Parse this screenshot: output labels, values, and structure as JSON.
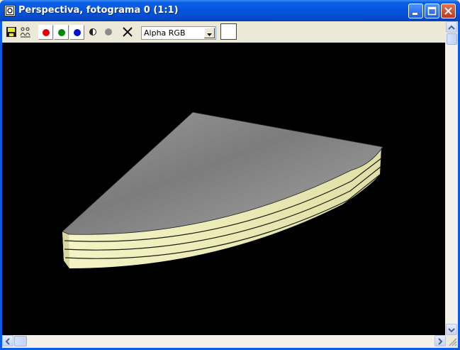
{
  "window": {
    "title": "Perspectiva, fotograma 0 (1:1)",
    "icon": "frame-window-icon"
  },
  "title_buttons": [
    "minimize-button",
    "maximize-button",
    "close-button"
  ],
  "toolbar": {
    "tools": [
      "save-icon",
      "clone-icon"
    ],
    "channels": [
      {
        "name": "red-channel-button",
        "color": "#e30000"
      },
      {
        "name": "green-channel-button",
        "color": "#008a00"
      },
      {
        "name": "blue-channel-button",
        "color": "#0010d0"
      }
    ],
    "monochrome_icon": "half-circle-icon",
    "alpha_icon": "gray-dot-icon",
    "clear_icon": "close-x-icon",
    "channel_select": {
      "value": "Alpha RGB"
    },
    "swatch_color": "#ffffff"
  },
  "viewport": {
    "background": "#000000",
    "object": "quarter-round-layered-slab",
    "top_color": "#8a8a8a",
    "side_color": "#f2f2bf"
  }
}
